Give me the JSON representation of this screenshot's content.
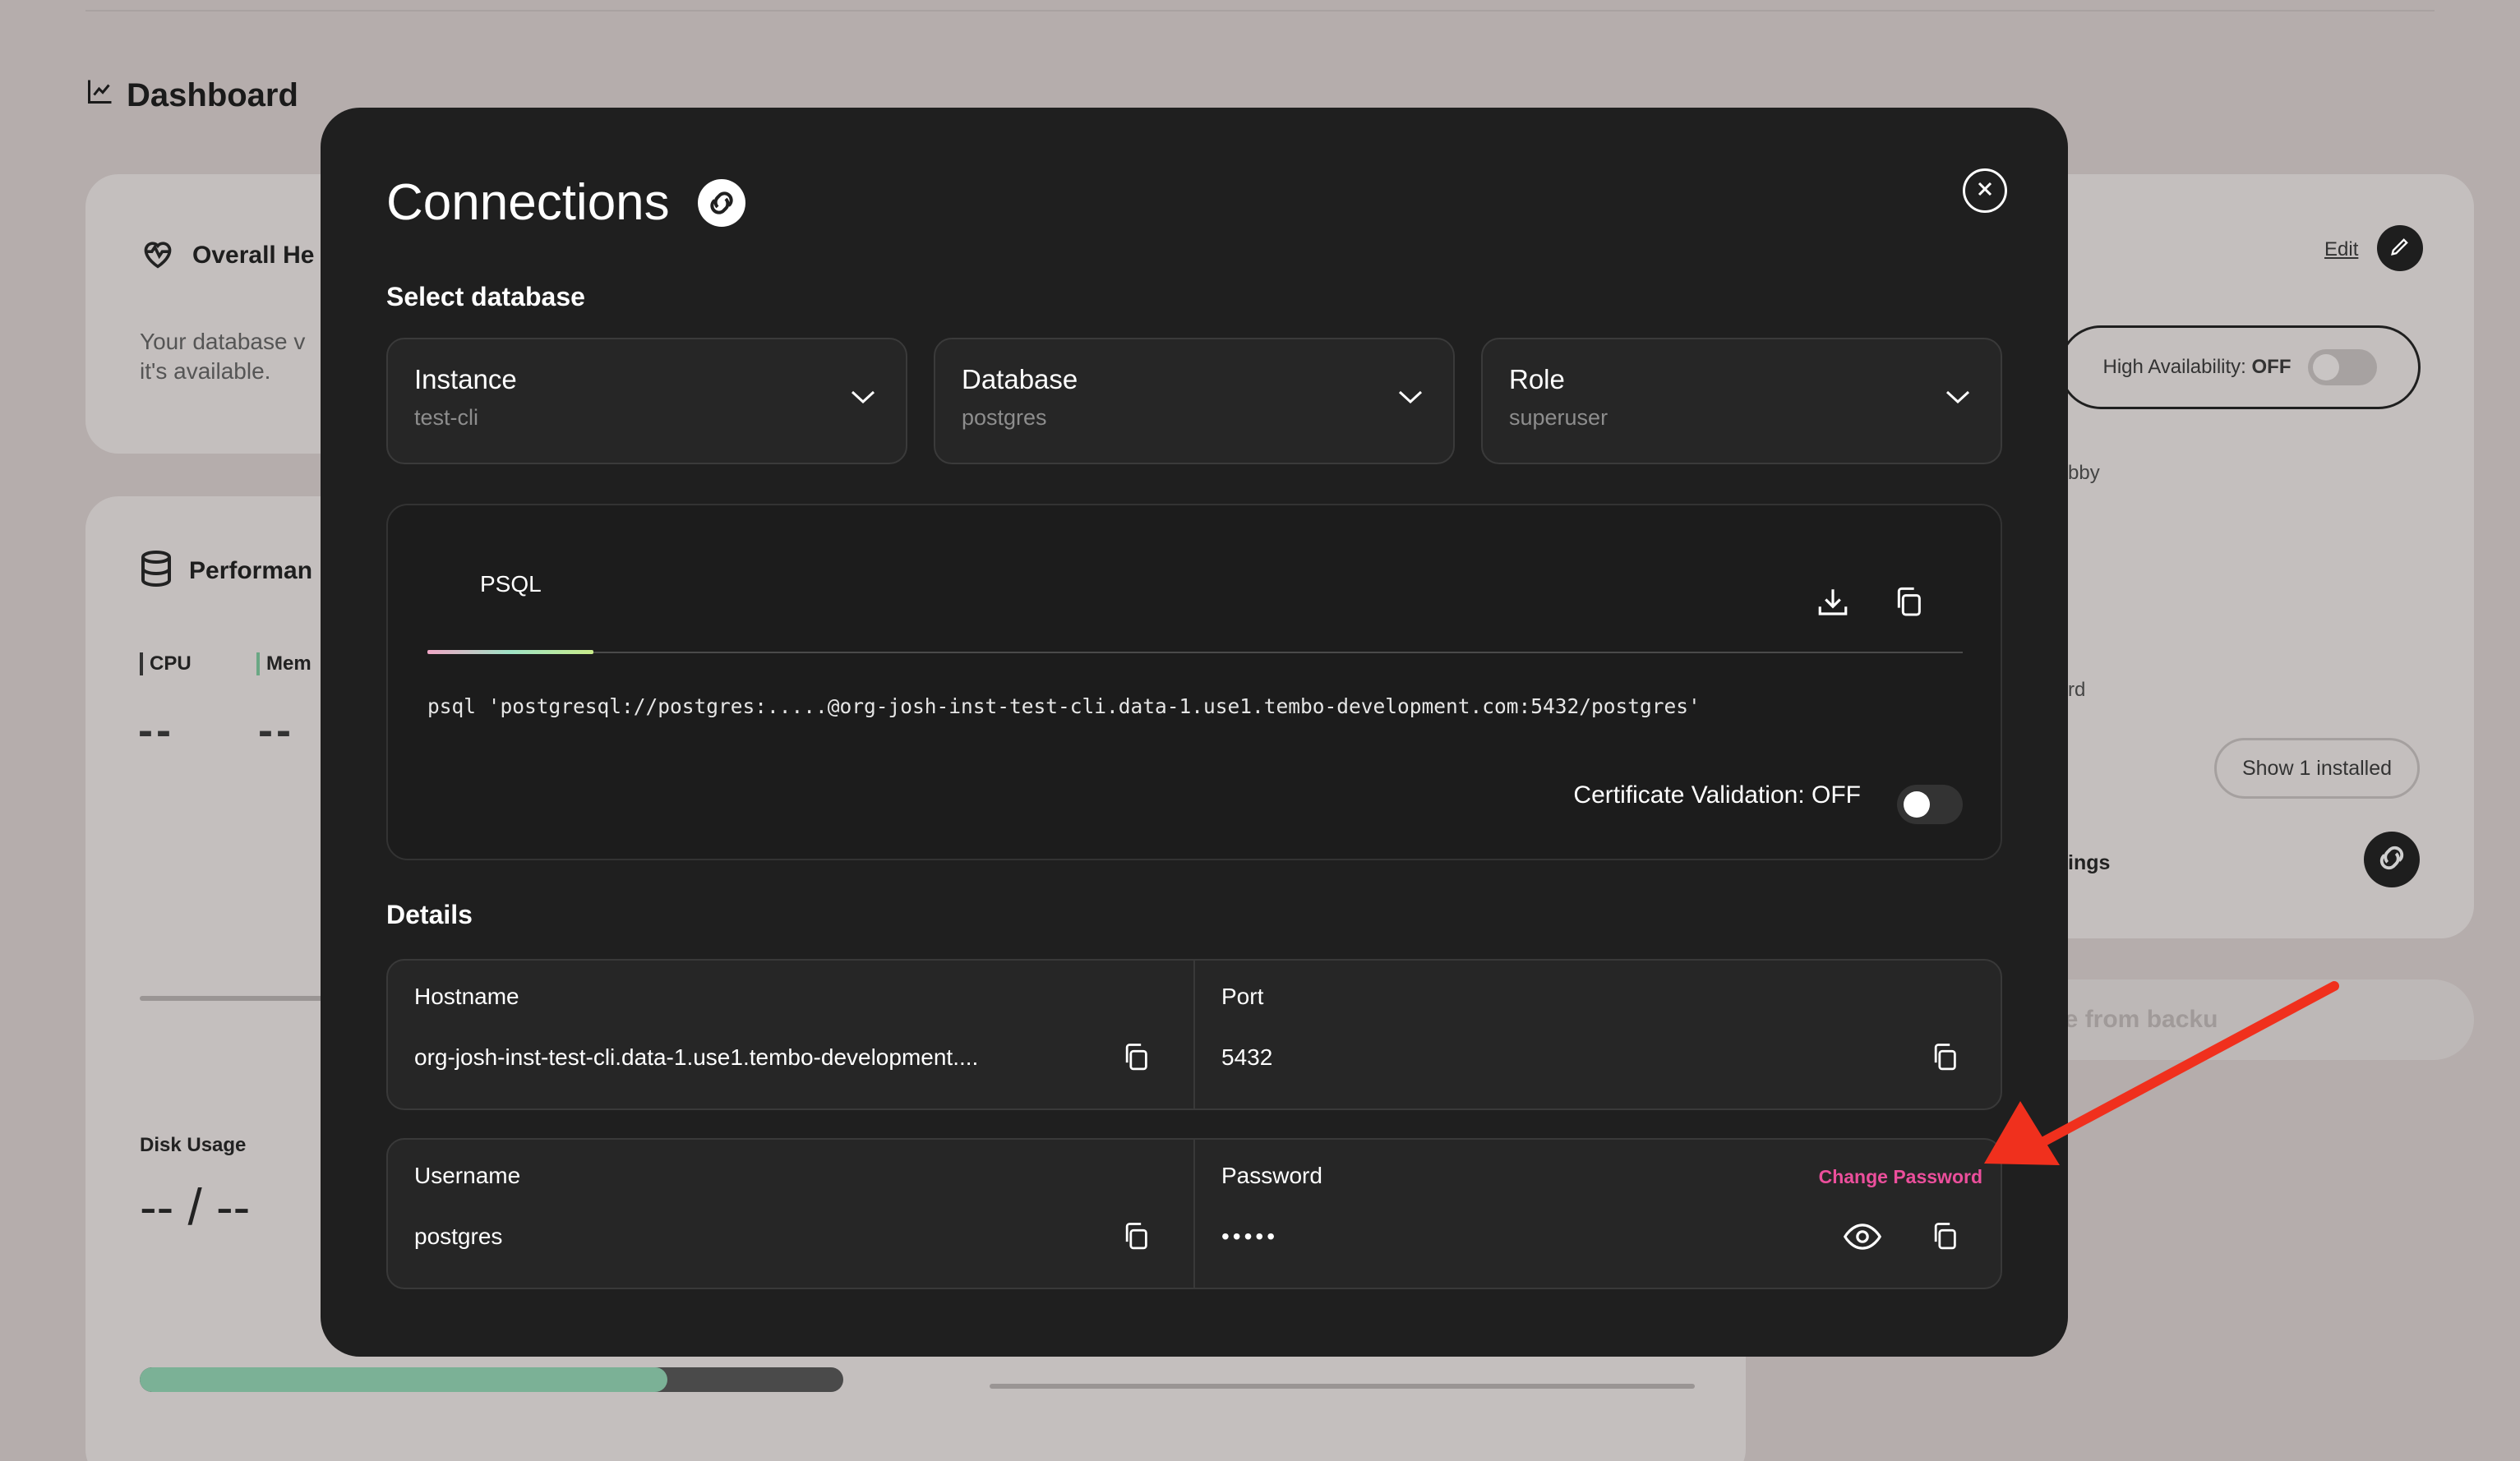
{
  "dashboard": {
    "title": "Dashboard",
    "overall_health_title": "Overall He",
    "health_text_line1": "Your database v",
    "health_text_line2": "it's available.",
    "performance_title": "Performan",
    "cpu_label": "CPU",
    "memory_label": "Mem",
    "cpu_value": "--",
    "memory_value": "--",
    "disk_usage_label": "Disk Usage",
    "disk_usage_value": "-- / --",
    "disk_fill_fraction": 0.75,
    "edit_link": "Edit",
    "high_availability_label": "High Availability:",
    "high_availability_value": "OFF",
    "partial_text_1": "bby",
    "partial_text_2": "rd",
    "show_installed": "Show 1 installed",
    "partial_text_3": "ings",
    "restore_button": "re from backu"
  },
  "modal": {
    "title": "Connections",
    "select_database_label": "Select database",
    "selects": [
      {
        "label": "Instance",
        "value": "test-cli"
      },
      {
        "label": "Database",
        "value": "postgres"
      },
      {
        "label": "Role",
        "value": "superuser"
      }
    ],
    "tab_label": "PSQL",
    "connection_string": "psql 'postgresql://postgres:.....@org-josh-inst-test-cli.data-1.use1.tembo-development.com:5432/postgres'",
    "certificate_validation_label": "Certificate Validation: OFF",
    "details_label": "Details",
    "details": {
      "hostname_label": "Hostname",
      "hostname_value": "org-josh-inst-test-cli.data-1.use1.tembo-development....",
      "port_label": "Port",
      "port_value": "5432",
      "username_label": "Username",
      "username_value": "postgres",
      "password_label": "Password",
      "password_value": "•••••",
      "change_password": "Change Password"
    }
  },
  "colors": {
    "modal_bg": "#1f1f1f",
    "accent_pink": "#ec4f9c",
    "annotation_arrow": "#f0301d"
  }
}
